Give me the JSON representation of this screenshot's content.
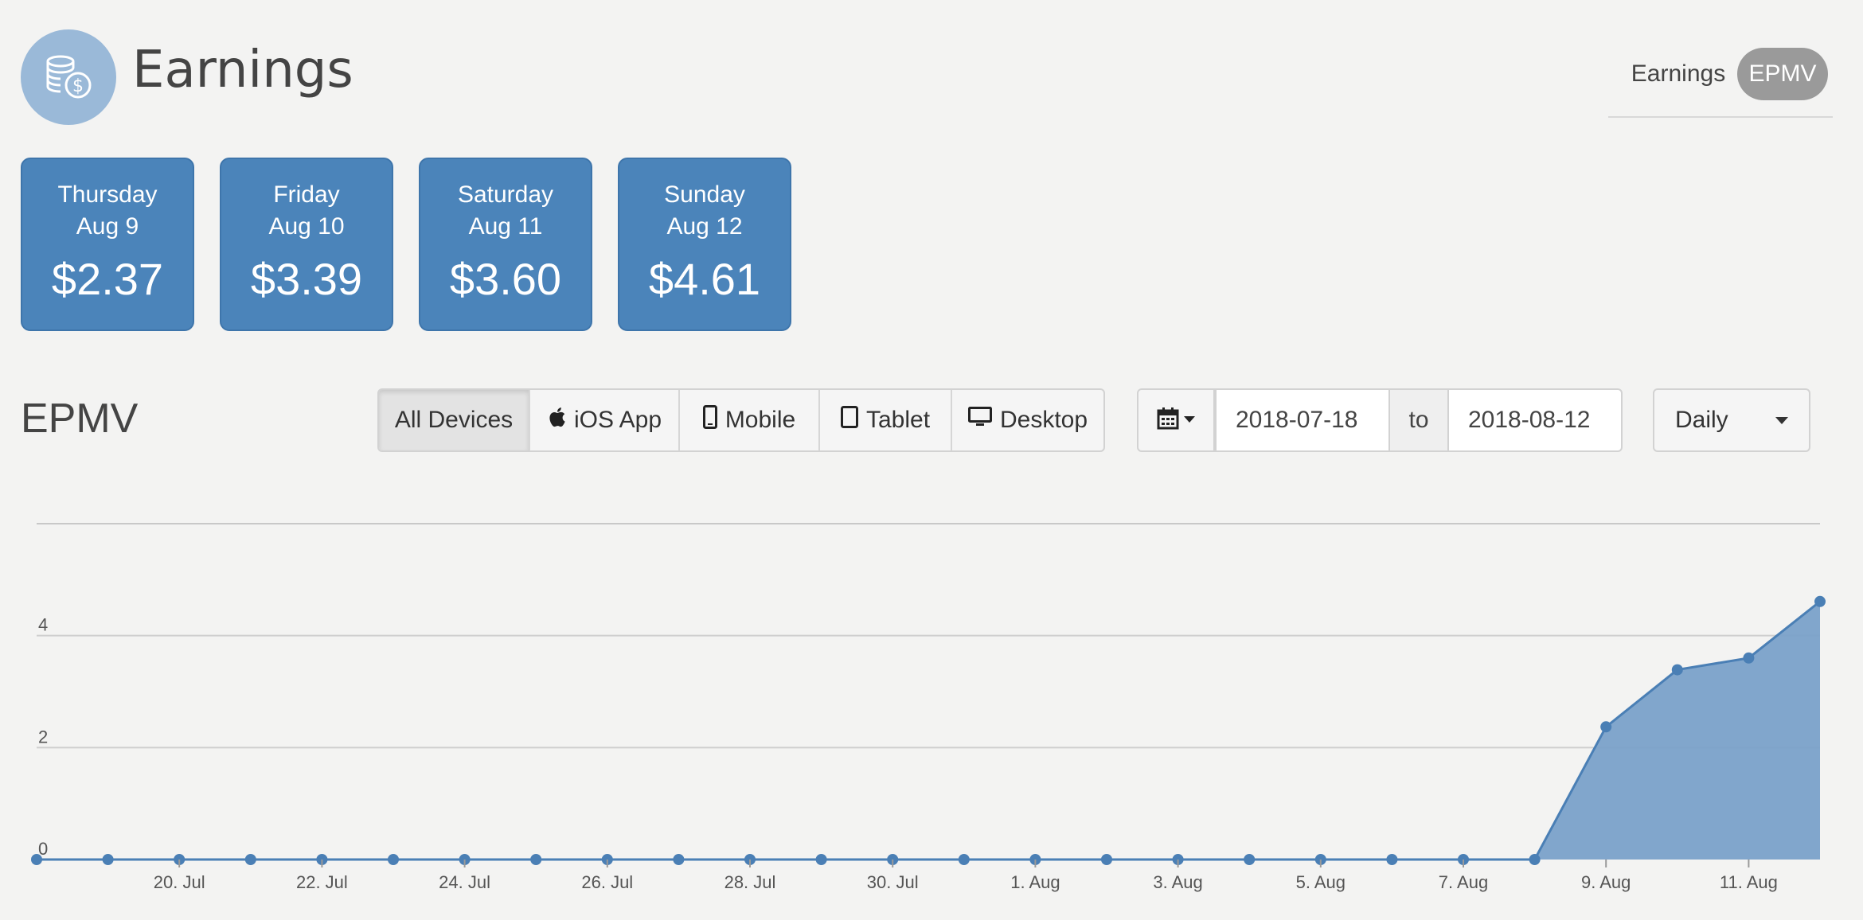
{
  "header": {
    "title": "Earnings",
    "icon": "coins-dollar-icon"
  },
  "view_toggle": {
    "earnings_label": "Earnings",
    "epmv_label": "EPMV",
    "active": "EPMV"
  },
  "day_cards": [
    {
      "weekday": "Thursday",
      "date": "Aug 9",
      "amount": "$2.37"
    },
    {
      "weekday": "Friday",
      "date": "Aug 10",
      "amount": "$3.39"
    },
    {
      "weekday": "Saturday",
      "date": "Aug 11",
      "amount": "$3.60"
    },
    {
      "weekday": "Sunday",
      "date": "Aug 12",
      "amount": "$4.61"
    }
  ],
  "section_title": "EPMV",
  "devices": [
    {
      "label": "All Devices",
      "icon": "",
      "active": true
    },
    {
      "label": "iOS App",
      "icon": "apple-icon",
      "active": false
    },
    {
      "label": "Mobile",
      "icon": "mobile-phone-icon",
      "active": false
    },
    {
      "label": "Tablet",
      "icon": "tablet-icon",
      "active": false
    },
    {
      "label": "Desktop",
      "icon": "desktop-icon",
      "active": false
    }
  ],
  "date_range": {
    "start": "2018-07-18",
    "to_label": "to",
    "end": "2018-08-12",
    "icon": "calendar-icon"
  },
  "period": {
    "selected": "Daily"
  },
  "colors": {
    "accent": "#4b84ba",
    "card_border": "#3e75ab",
    "area_fill": "#7aa1c9",
    "line": "#4a7fb5",
    "icon_bg": "#9ab9d8"
  },
  "chart_data": {
    "type": "area",
    "x": [
      "2018-07-18",
      "2018-07-19",
      "2018-07-20",
      "2018-07-21",
      "2018-07-22",
      "2018-07-23",
      "2018-07-24",
      "2018-07-25",
      "2018-07-26",
      "2018-07-27",
      "2018-07-28",
      "2018-07-29",
      "2018-07-30",
      "2018-07-31",
      "2018-08-01",
      "2018-08-02",
      "2018-08-03",
      "2018-08-04",
      "2018-08-05",
      "2018-08-06",
      "2018-08-07",
      "2018-08-08",
      "2018-08-09",
      "2018-08-10",
      "2018-08-11",
      "2018-08-12"
    ],
    "series": [
      {
        "values": [
          0,
          0,
          0,
          0,
          0,
          0,
          0,
          0,
          0,
          0,
          0,
          0,
          0,
          0,
          0,
          0,
          0,
          0,
          0,
          0,
          0,
          0,
          2.37,
          3.39,
          3.6,
          4.61
        ]
      }
    ],
    "x_tick_labels": [
      "20. Jul",
      "22. Jul",
      "24. Jul",
      "26. Jul",
      "28. Jul",
      "30. Jul",
      "1. Aug",
      "3. Aug",
      "5. Aug",
      "7. Aug",
      "9. Aug",
      "11. Aug"
    ],
    "y_ticks": [
      0,
      2,
      4
    ],
    "ylim": [
      0,
      6
    ],
    "grid": true,
    "legend": "none"
  }
}
